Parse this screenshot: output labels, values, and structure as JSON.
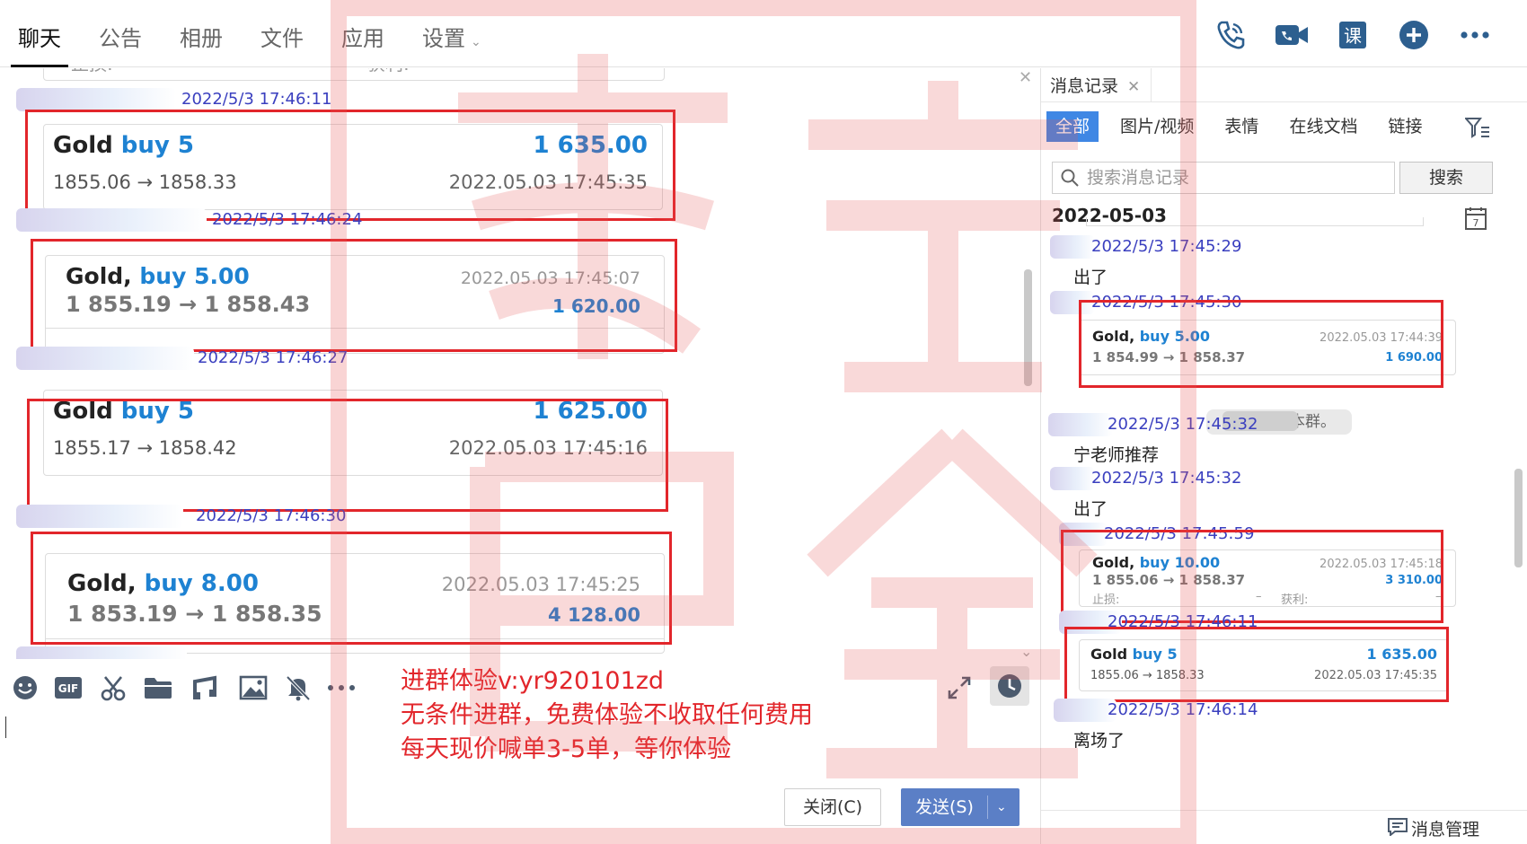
{
  "nav": {
    "tabs": [
      "聊天",
      "公告",
      "相册",
      "文件",
      "应用",
      "设置"
    ],
    "active": "聊天"
  },
  "top_icons": [
    "phone-icon",
    "video-call-icon",
    "course-icon",
    "add-icon",
    "more-icon"
  ],
  "top_icon_text": {
    "course": "课"
  },
  "chat": {
    "partial_top": {
      "stop_loss_label": "止损:",
      "take_profit_label": "获利:",
      "dash": "–"
    },
    "messages": [
      {
        "time": "2022/5/3 17:46:11",
        "card": {
          "symbol": "Gold",
          "action": "buy 5",
          "price_range": "1855.06 → 1858.33",
          "profit": "1 635.00",
          "trade_time": "2022.05.03 17:45:35"
        }
      },
      {
        "time": "2022/5/3 17:46:24",
        "card": {
          "symbol": "Gold,",
          "action": "buy 5.00",
          "price_range": "1 855.19 → 1 858.43",
          "profit": "1 620.00",
          "trade_time": "2022.05.03 17:45:07"
        }
      },
      {
        "time": "2022/5/3 17:46:27",
        "card": {
          "symbol": "Gold",
          "action": "buy 5",
          "price_range": "1855.17 → 1858.42",
          "profit": "1 625.00",
          "trade_time": "2022.05.03 17:45:16"
        }
      },
      {
        "time": "2022/5/3 17:46:30",
        "card": {
          "symbol": "Gold,",
          "action": "buy 8.00",
          "price_range": "1 853.19 → 1 858.35",
          "profit": "4 128.00",
          "trade_time": "2022.05.03 17:45:25"
        }
      }
    ]
  },
  "toolbar": {
    "tools": [
      "emoji-icon",
      "gif-icon",
      "scissors-icon",
      "folder-icon",
      "music-icon",
      "image-icon",
      "mute-icon",
      "more-icon"
    ],
    "gif_label": "GIF"
  },
  "promo": {
    "line1": "进群体验v:yr920101zd",
    "line2": "无条件进群，免费体验不收取任何费用",
    "line3": "每天现价喊单3-5单，等你体验"
  },
  "input": {
    "close_label": "关闭(C)",
    "send_label": "发送(S)"
  },
  "right_panel": {
    "tab_title": "消息记录",
    "filters": [
      "全部",
      "图片/视频",
      "表情",
      "在线文档",
      "链接"
    ],
    "active_filter": "全部",
    "search_placeholder": "搜索消息记录",
    "search_button": "搜索",
    "date": "2022-05-03",
    "calendar_day": "7",
    "entries": [
      {
        "time": "2022/5/3 17:45:29",
        "text": "出了"
      },
      {
        "time": "2022/5/3 17:45:30",
        "card": {
          "symbol": "Gold,",
          "action": "buy 5.00",
          "price_range": "1 854.99 → 1 858.37",
          "profit": "1 690.00",
          "trade_time": "2022.05.03 17:44:39"
        }
      },
      {
        "notice": "加入本群。"
      },
      {
        "time": "2022/5/3 17:45:32",
        "text": "宁老师推荐"
      },
      {
        "time": "2022/5/3 17:45:32",
        "text": "出了"
      },
      {
        "time": "2022/5/3 17:45:59",
        "card": {
          "symbol": "Gold,",
          "action": "buy 10.00",
          "price_range": "1 855.06 → 1 858.37",
          "profit": "3 310.00",
          "trade_time": "2022.05.03 17:45:18",
          "stop_loss_label": "止损:",
          "take_profit_label": "获利:",
          "dash": "–"
        }
      },
      {
        "time": "2022/5/3 17:46:11",
        "card": {
          "symbol": "Gold",
          "action": "buy 5",
          "price_range": "1855.06 → 1858.33",
          "profit": "1 635.00",
          "trade_time": "2022.05.03 17:45:35"
        }
      },
      {
        "time": "2022/5/3 17:46:14",
        "text": "离场了"
      }
    ],
    "footer_label": "消息管理"
  },
  "colors": {
    "accent_blue": "#3f87e4",
    "timestamp_blue": "#3a3fbf",
    "buy_blue": "#1e82d2",
    "highlight_red": "#e2262b",
    "send_button": "#5b7fc6"
  }
}
